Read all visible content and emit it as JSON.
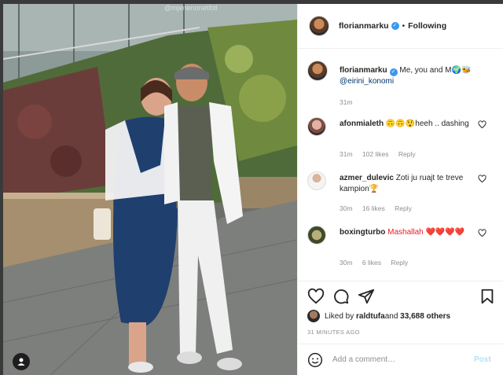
{
  "post": {
    "watermark": "@mjenenonetlbtl",
    "author": "florianmarku",
    "verified_mark": "✓",
    "dot": "•",
    "follow_state": "Following",
    "caption_text": "Me, you and M",
    "caption_emojis": "🌍🐝",
    "caption_tag": "@eirini_konomi",
    "caption_time": "31m",
    "likes_prefix": "Liked by ",
    "likes_user": "raldtufa",
    "likes_and": " and ",
    "likes_others": "33,688 others",
    "posted_ago": "31 MINUTES AGO",
    "add_comment_placeholder": "Add a comment…",
    "post_button": "Post"
  },
  "comments": [
    {
      "user": "afonmialeth",
      "text": "🙃🙃😲heeh .. dashing",
      "time": "31m",
      "likes": "102 likes",
      "reply": "Reply"
    },
    {
      "user": "azmer_dulevic",
      "text": "Zoti ju ruajt te treve kampion🏆",
      "time": "30m",
      "likes": "16 likes",
      "reply": "Reply"
    },
    {
      "user": "boxingturbo",
      "text": "Mashallah ❤️❤️❤️❤️",
      "time": "30m",
      "likes": "6 likes",
      "reply": "Reply"
    }
  ],
  "colors": {
    "link": "#00376b",
    "verified": "#3897f0",
    "muted": "#8e8e8e",
    "post_button": "#b2dffc"
  }
}
